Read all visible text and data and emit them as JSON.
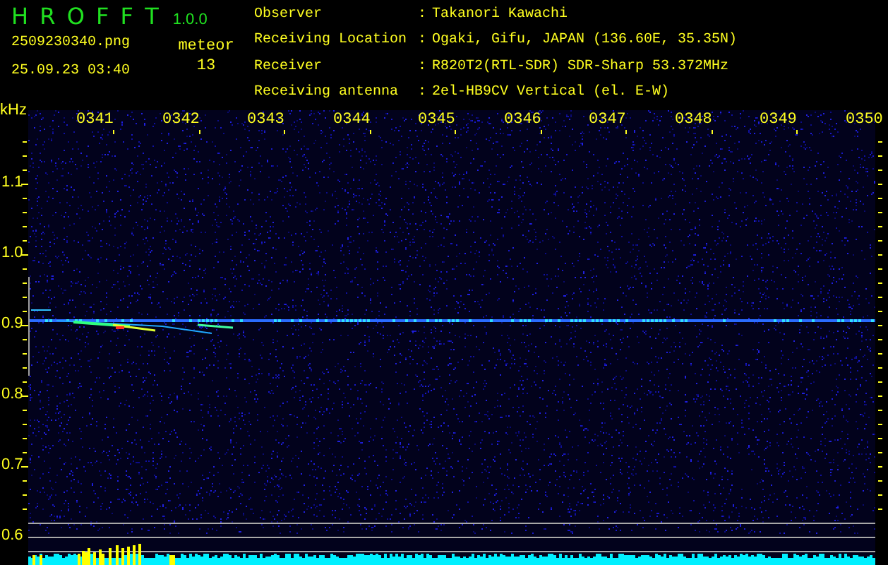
{
  "app": {
    "name": "H R O F F T",
    "version": "1.0.0"
  },
  "file": {
    "name": "2509230340.png",
    "datetime": "25.09.23 03:40"
  },
  "counter": {
    "label": "meteor",
    "value": "13"
  },
  "station": [
    {
      "label": "Observer",
      "separator": ":",
      "value": "Takanori Kawachi"
    },
    {
      "label": "Receiving Location",
      "separator": ":",
      "value": "Ogaki, Gifu, JAPAN (136.60E, 35.35N)"
    },
    {
      "label": "Receiver",
      "separator": ":",
      "value": "R820T2(RTL-SDR) SDR-Sharp 53.372MHz"
    },
    {
      "label": "Receiving antenna",
      "separator": ":",
      "value": "2el-HB9CV Vertical (el. E-W)"
    }
  ],
  "spectrogram": {
    "unit": "kHz",
    "x_labels": [
      "0341",
      "0342",
      "0343",
      "0344",
      "0345",
      "0346",
      "0347",
      "0348",
      "0349",
      "0350"
    ],
    "y_labels": [
      "1.1",
      "1.0",
      "0.9",
      "0.8",
      "0.7",
      "0.6"
    ]
  }
}
